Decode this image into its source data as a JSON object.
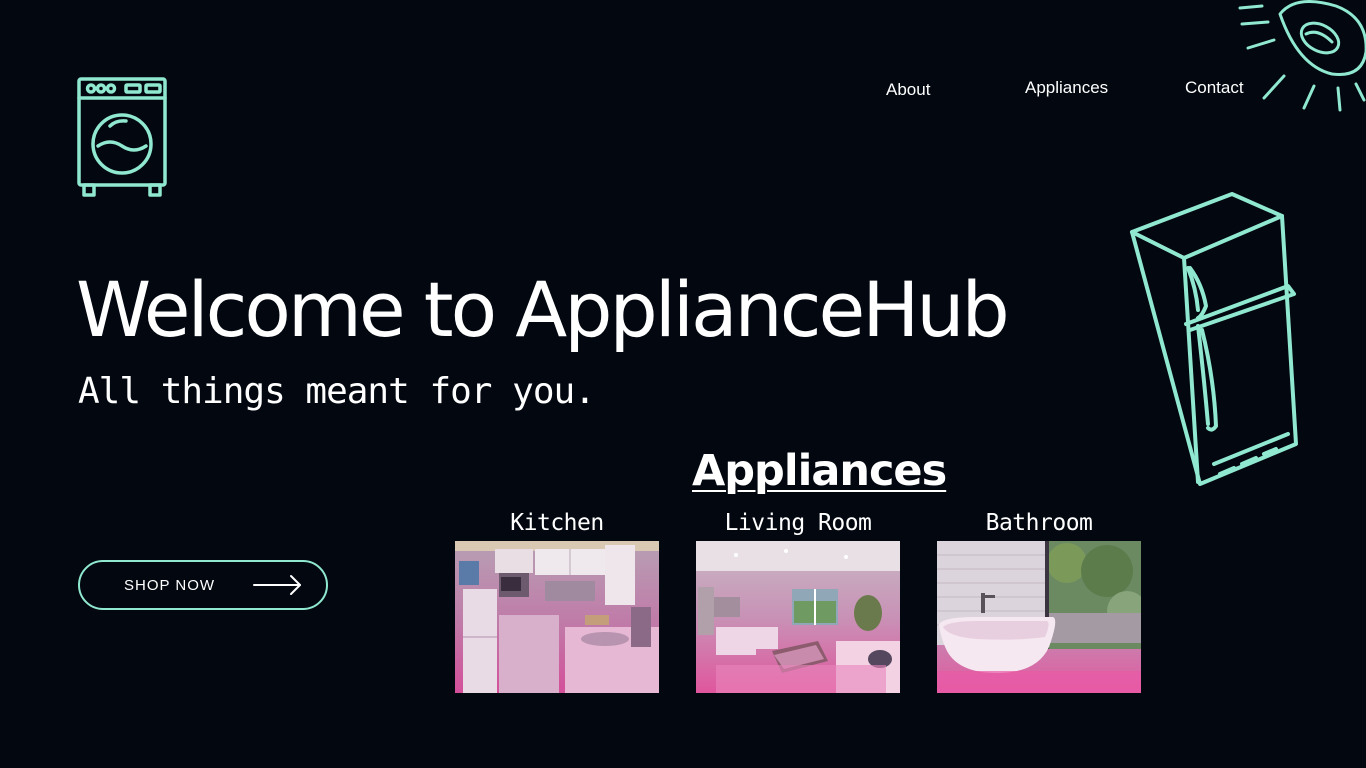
{
  "nav": {
    "about": "About",
    "appliances": "Appliances",
    "contact": "Contact"
  },
  "hero": {
    "title": "Welcome to ApplianceHub",
    "subtitle": "All things meant for you."
  },
  "cta": {
    "label": "SHOP NOW"
  },
  "section": {
    "title": "Appliances",
    "categories": [
      {
        "label": "Kitchen",
        "image": "kitchen-photo"
      },
      {
        "label": "Living Room",
        "image": "living-room-photo"
      },
      {
        "label": "Bathroom",
        "image": "bathroom-photo"
      }
    ]
  },
  "theme": {
    "background": "#020710",
    "accent": "#8fe8cf",
    "text": "#ffffff",
    "photo_tint": "#e0559a"
  },
  "icons": [
    "washing-machine-icon",
    "arrow-right-icon",
    "lamp-icon",
    "refrigerator-icon"
  ]
}
